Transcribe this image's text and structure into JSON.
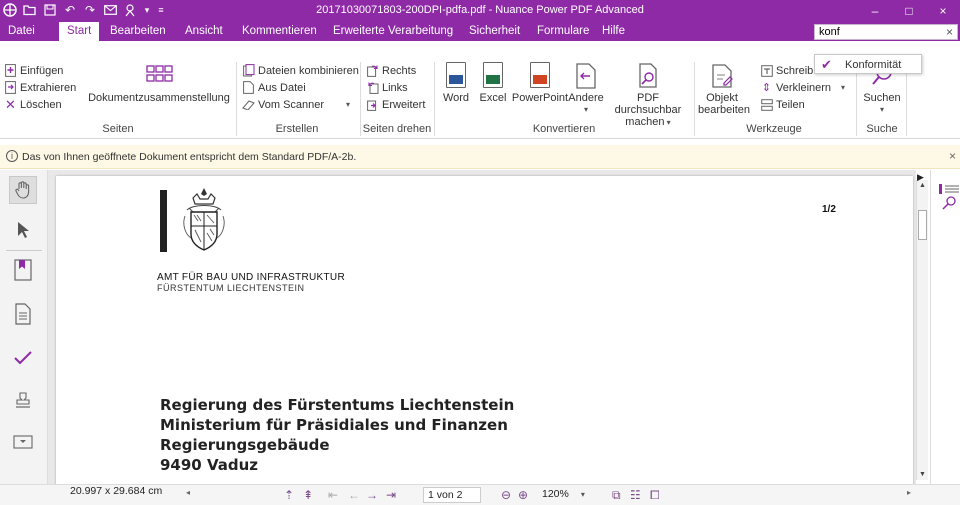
{
  "window": {
    "title": "20171030071803-200DPI-pdfa.pdf - Nuance Power PDF Advanced",
    "controls": {
      "minimize": "–",
      "maximize": "□",
      "close": "×"
    }
  },
  "tabs": [
    "Datei",
    "Start",
    "Bearbeiten",
    "Ansicht",
    "Kommentieren",
    "Erweiterte Verarbeitung",
    "Sicherheit",
    "Formulare",
    "Hilfe"
  ],
  "active_tab": "Start",
  "search": {
    "value": "konf",
    "clear": "×",
    "suggestion": "Konformität"
  },
  "ribbon": {
    "seiten": {
      "einfuegen": "Einfügen",
      "extrahieren": "Extrahieren",
      "loeschen": "Löschen",
      "dokumentzusammenstellung": "Dokumentzusammenstellung",
      "label": "Seiten"
    },
    "erstellen": {
      "kombinieren": "Dateien kombinieren",
      "aus_datei": "Aus Datei",
      "vom_scanner": "Vom Scanner",
      "label": "Erstellen"
    },
    "seiten_drehen": {
      "rechts": "Rechts",
      "links": "Links",
      "erweitert": "Erweitert",
      "label": "Seiten drehen"
    },
    "konvertieren": {
      "word": "Word",
      "excel": "Excel",
      "powerpoint": "PowerPoint",
      "andere": "Andere",
      "pdf_line1": "PDF durchsuchbar",
      "pdf_line2": "machen",
      "label": "Konvertieren"
    },
    "werkzeuge": {
      "objekt_line1": "Objekt",
      "objekt_line2": "bearbeiten",
      "schreibmaschine": "Schreibr",
      "verkleinern": "Verkleinern",
      "teilen": "Teilen",
      "label": "Werkzeuge"
    },
    "suche": {
      "suchen": "Suchen",
      "label": "Suche"
    }
  },
  "infobar": {
    "message": "Das von Ihnen geöffnete Dokument entspricht dem Standard PDF/A-2b.",
    "close": "×"
  },
  "document": {
    "org_line1": "AMT FÜR BAU UND INFRASTRUKTUR",
    "org_line2": "FÜRSTENTUM LIECHTENSTEIN",
    "page_marker": "1/2",
    "address": [
      "Regierung des Fürstentums Liechtenstein",
      "Ministerium für Präsidiales und Finanzen",
      "Regierungsgebäude",
      "9490 Vaduz"
    ]
  },
  "status": {
    "dimensions": "20.997 x 29.684 cm",
    "page_field": "1 von 2",
    "zoom": "120%"
  },
  "colors": {
    "accent": "#8e2aa6",
    "info_bg": "#fdf9e6"
  }
}
